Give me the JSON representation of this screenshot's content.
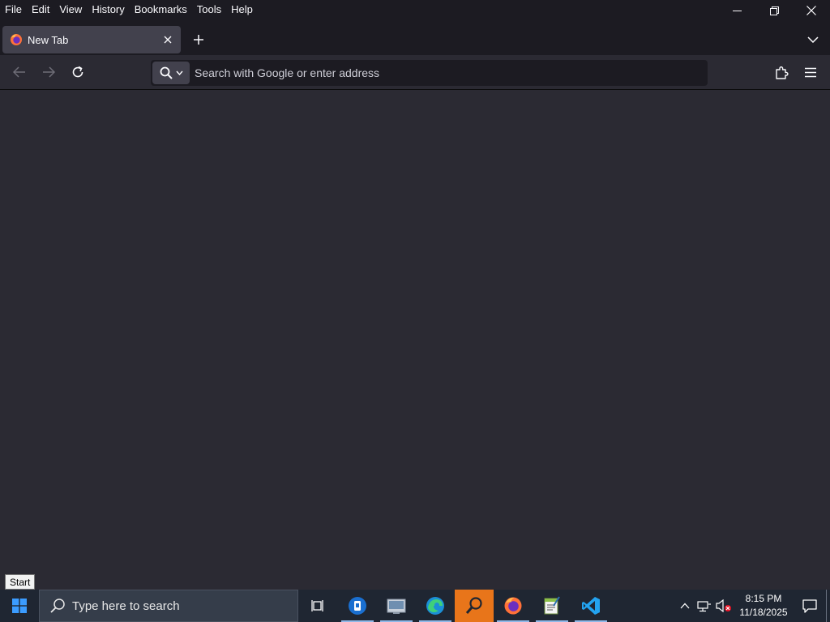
{
  "menubar": {
    "items": [
      "File",
      "Edit",
      "View",
      "History",
      "Bookmarks",
      "Tools",
      "Help"
    ]
  },
  "window_controls": {
    "minimize_icon": "minimize-icon",
    "restore_icon": "restore-icon",
    "close_icon": "close-icon"
  },
  "tab": {
    "title": "New Tab",
    "favicon": "firefox-icon"
  },
  "navbar": {
    "search_placeholder": "Search with Google or enter address"
  },
  "tooltip": {
    "text": "Start"
  },
  "taskbar": {
    "search_placeholder": "Type here to search",
    "apps": [
      "task-view-icon",
      "app-blue-icon",
      "file-explorer-icon",
      "edge-icon",
      "search-tool-icon",
      "firefox-icon",
      "notepad-icon",
      "vscode-icon"
    ],
    "clock": {
      "time": "8:15 PM",
      "date": "11/18/2025"
    }
  },
  "colors": {
    "chrome_bg": "#1c1b22",
    "content_bg": "#2b2a33",
    "tab_active": "#42414d",
    "taskbar_bg": "#1f2632",
    "taskbar_active": "#e8751a"
  }
}
